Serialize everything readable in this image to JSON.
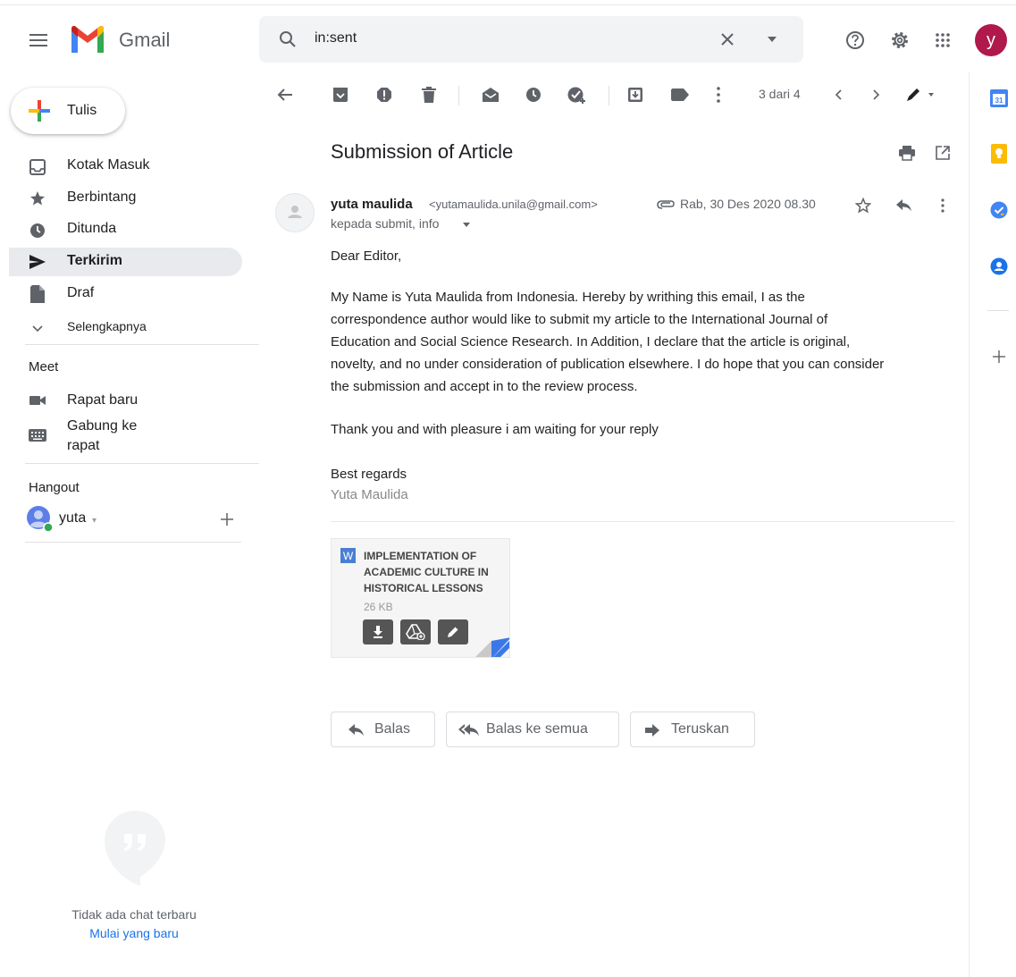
{
  "header": {
    "app_name": "Gmail",
    "search_query": "in:sent",
    "avatar_letter": "y"
  },
  "sidebar": {
    "compose_label": "Tulis",
    "items": [
      {
        "label": "Kotak Masuk",
        "icon": "inbox-icon"
      },
      {
        "label": "Berbintang",
        "icon": "star-icon"
      },
      {
        "label": "Ditunda",
        "icon": "clock-icon"
      },
      {
        "label": "Terkirim",
        "icon": "send-icon",
        "active": true
      },
      {
        "label": "Draf",
        "icon": "file-icon"
      },
      {
        "label": "Selengkapnya",
        "icon": "chevron-down-icon"
      }
    ],
    "meet": {
      "title": "Meet",
      "new_meeting": "Rapat baru",
      "join_meeting": "Gabung ke rapat"
    },
    "hangout": {
      "title": "Hangout",
      "user": "yuta",
      "empty_text": "Tidak ada chat terbaru",
      "start_link": "Mulai yang baru"
    }
  },
  "toolbar": {
    "pager": "3 dari 4"
  },
  "message": {
    "subject": "Submission of Article",
    "sender_name": "yuta maulida",
    "sender_email": "<yutamaulida.unila@gmail.com>",
    "date": "Rab, 30 Des 2020 08.30",
    "recipients": "kepada submit, info",
    "greeting": "Dear Editor,",
    "paragraph1_lines": [
      "My Name is Yuta Maulida from Indonesia. Hereby by writhing this email, I as the",
      "correspondence author would like to submit my article to the International Journal of",
      "Education and Social Science Research. In Addition, I declare that the article is original,",
      "novelty, and no under consideration of publication elsewhere. I do  hope that you can consider",
      "the submission and accept in to the review process."
    ],
    "paragraph2": "Thank you and with pleasure i am waiting for your reply",
    "closing": "Best regards",
    "signature": "Yuta Maulida"
  },
  "attachment": {
    "type_letter": "W",
    "name": "IMPLEMENTATION OF ACADEMIC CULTURE IN HISTORICAL LESSONS",
    "size": "26 KB"
  },
  "actions": {
    "reply": "Balas",
    "reply_all": "Balas ke semua",
    "forward": "Teruskan"
  },
  "colors": {
    "accent_blue": "#1a73e8",
    "avatar_bg": "#b0194b",
    "active_nav_bg": "#e8eaed"
  }
}
